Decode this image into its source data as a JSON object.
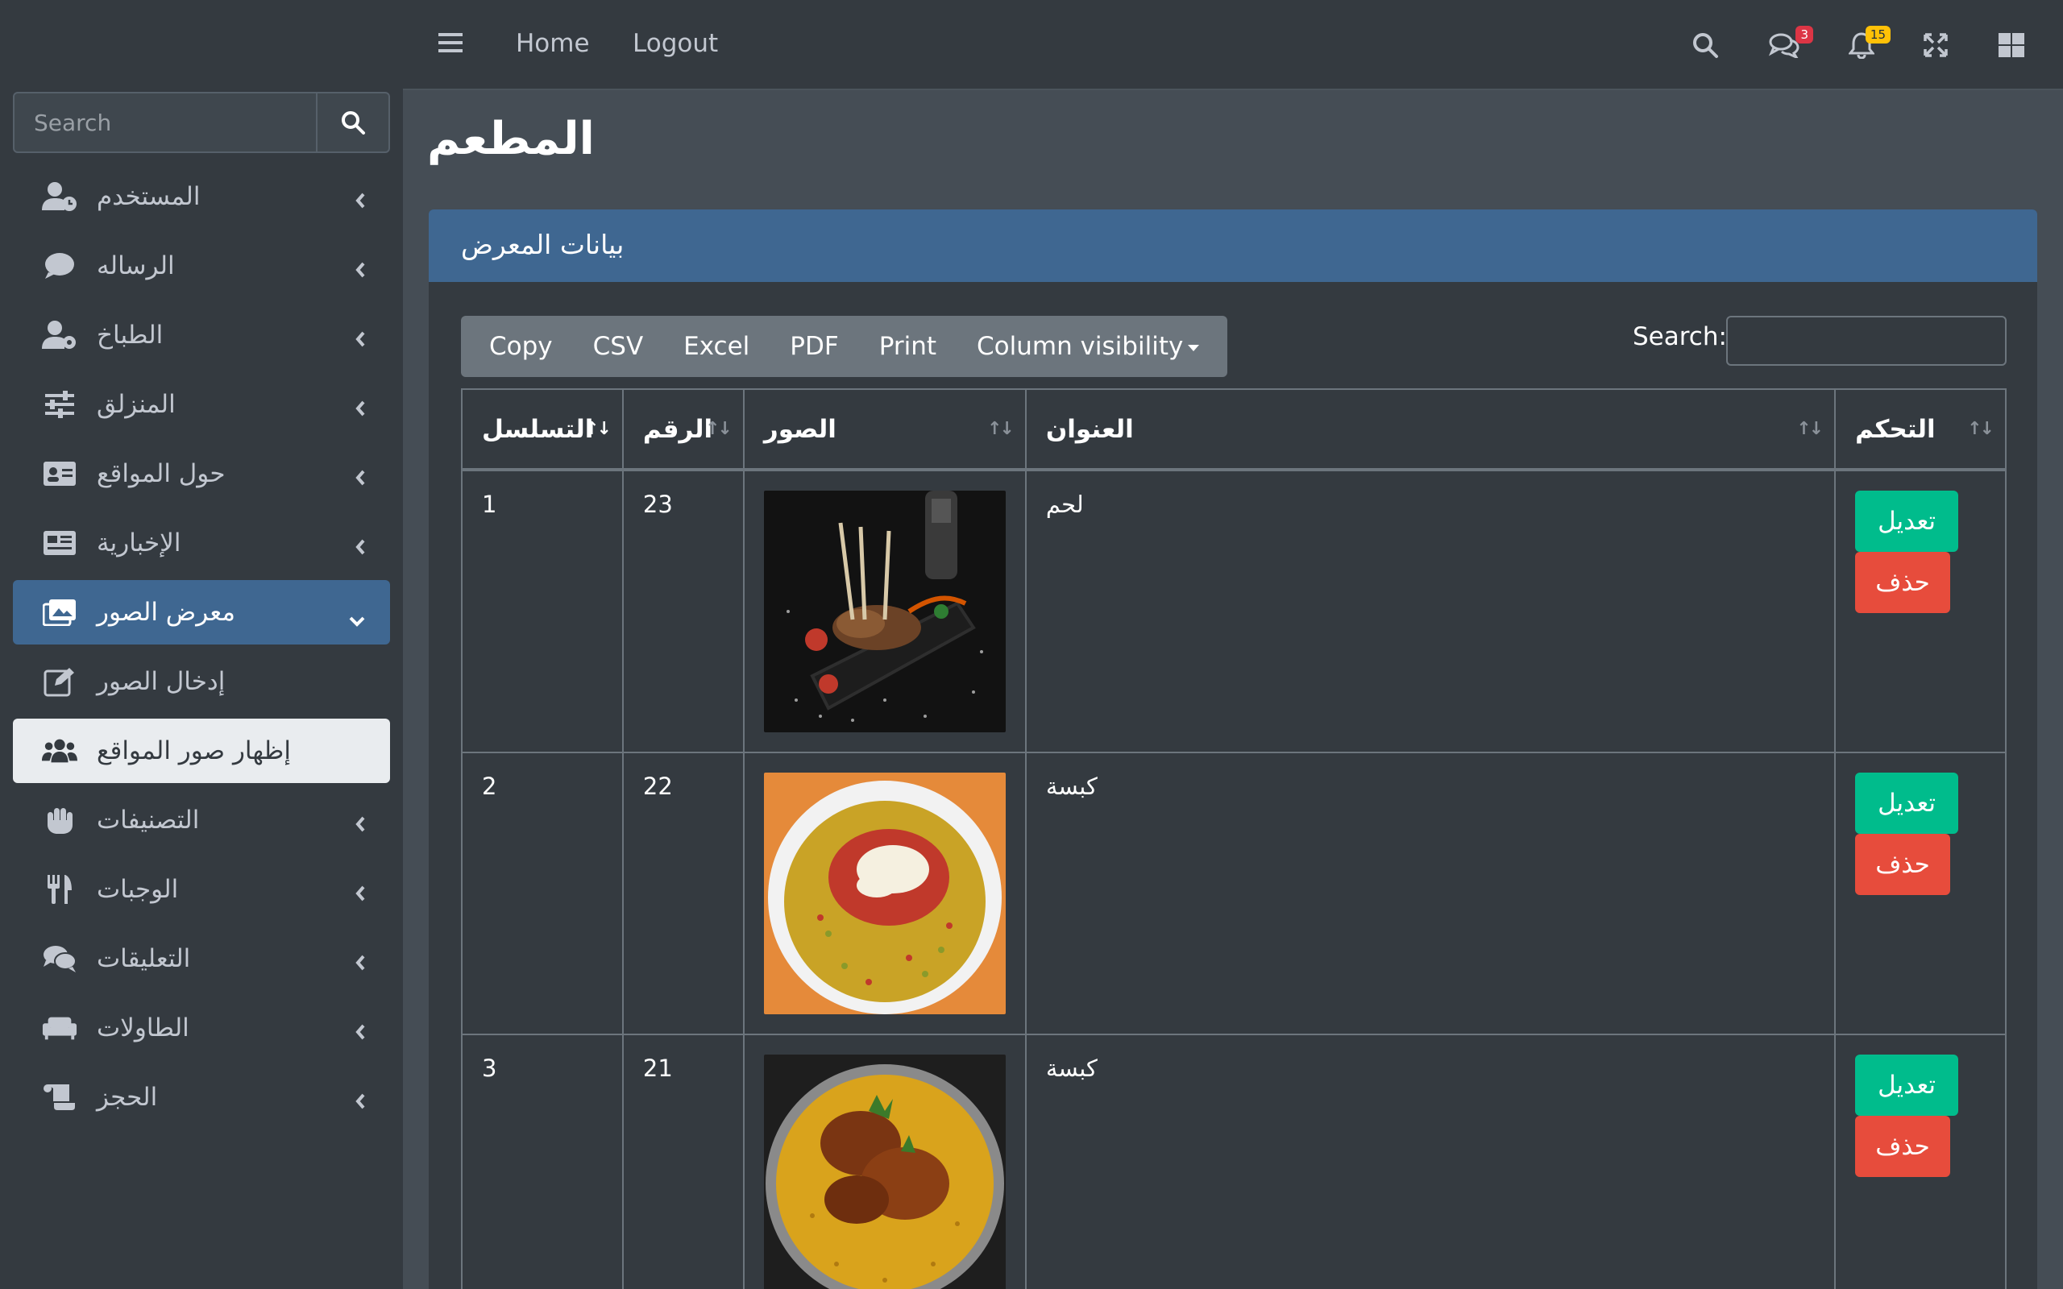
{
  "sidebar": {
    "search_placeholder": "Search",
    "items": [
      {
        "label": "المستخدم",
        "icon": "user-clock-icon"
      },
      {
        "label": "الرساله",
        "icon": "comment-icon"
      },
      {
        "label": "الطباخ",
        "icon": "user-cog-icon"
      },
      {
        "label": "المنزلق",
        "icon": "sliders-icon"
      },
      {
        "label": "حول المواقع",
        "icon": "id-card-icon"
      },
      {
        "label": "الإخبارية",
        "icon": "newspaper-icon"
      },
      {
        "label": "معرض الصور",
        "icon": "images-icon"
      },
      {
        "label": "إدخال الصور",
        "icon": "edit-icon"
      },
      {
        "label": "إظهار صور المواقع",
        "icon": "users-icon"
      },
      {
        "label": "التصنيفات",
        "icon": "hand-icon"
      },
      {
        "label": "الوجبات",
        "icon": "utensils-icon"
      },
      {
        "label": "التعليقات",
        "icon": "comments-icon"
      },
      {
        "label": "الطاولات",
        "icon": "couch-icon"
      },
      {
        "label": "الحجز",
        "icon": "scroll-icon"
      }
    ]
  },
  "topbar": {
    "home": "Home",
    "logout": "Logout",
    "messages_badge": "3",
    "notifications_badge": "15"
  },
  "page_title": "المطعم",
  "card": {
    "header": "بيانات المعرض",
    "buttons": [
      "Copy",
      "CSV",
      "Excel",
      "PDF",
      "Print",
      "Column visibility"
    ],
    "search_label": "Search:",
    "columns": [
      "التسلسل",
      "الرقم",
      "الصور",
      "العنوان",
      "التحكم"
    ],
    "rows": [
      {
        "seq": "1",
        "num": "23",
        "title": "لحم",
        "edit": "تعديل",
        "delete": "حذف"
      },
      {
        "seq": "2",
        "num": "22",
        "title": "كبسة",
        "edit": "تعديل",
        "delete": "حذف"
      },
      {
        "seq": "3",
        "num": "21",
        "title": "كبسة",
        "edit": "تعديل",
        "delete": "حذف"
      }
    ]
  },
  "colors": {
    "accent": "#3f6791",
    "edit": "#00bc8c",
    "delete": "#e74c3c",
    "sidebar": "#343a40",
    "content": "#454d55"
  }
}
